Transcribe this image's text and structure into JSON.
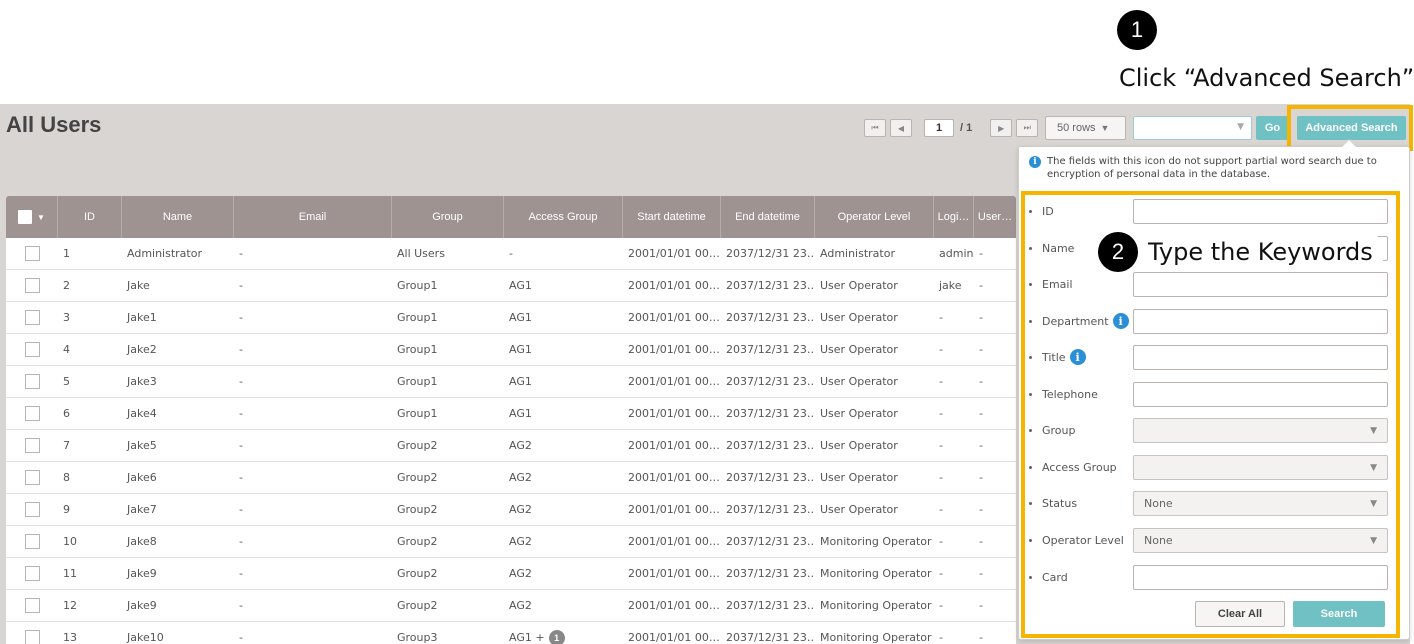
{
  "annotations": {
    "step1_number": "1",
    "step1_text": "Click “Advanced Search”",
    "step2_number": "2",
    "step2_text": "Type the Keywords",
    "highlight_color": "#f4b400"
  },
  "page": {
    "title": "All Users"
  },
  "pager": {
    "first_icon": "first-page-icon",
    "prev_icon": "prev-page-icon",
    "next_icon": "next-page-icon",
    "last_icon": "last-page-icon",
    "current_page": "1",
    "total": "/ 1"
  },
  "toolbar": {
    "rows_label": "50 rows",
    "go_label": "Go",
    "advanced_search_label": "Advanced Search",
    "accent_color": "#6fc1c4"
  },
  "table": {
    "columns": [
      "ID",
      "Name",
      "Email",
      "Group",
      "Access Group",
      "Start datetime",
      "End datetime",
      "Operator Level",
      "Logi…",
      "User…"
    ],
    "rows": [
      {
        "id": "1",
        "name": "Administrator",
        "email": "-",
        "group": "All Users",
        "access_group": "-",
        "start": "2001/01/01 00…",
        "end": "2037/12/31 23…",
        "level": "Administrator",
        "login": "admin",
        "user": "-"
      },
      {
        "id": "2",
        "name": "Jake",
        "email": "-",
        "group": "Group1",
        "access_group": "AG1",
        "start": "2001/01/01 00…",
        "end": "2037/12/31 23…",
        "level": "User Operator",
        "login": "jake",
        "user": "-"
      },
      {
        "id": "3",
        "name": "Jake1",
        "email": "-",
        "group": "Group1",
        "access_group": "AG1",
        "start": "2001/01/01 00…",
        "end": "2037/12/31 23…",
        "level": "User Operator",
        "login": "-",
        "user": "-"
      },
      {
        "id": "4",
        "name": "Jake2",
        "email": "-",
        "group": "Group1",
        "access_group": "AG1",
        "start": "2001/01/01 00…",
        "end": "2037/12/31 23…",
        "level": "User Operator",
        "login": "-",
        "user": "-"
      },
      {
        "id": "5",
        "name": "Jake3",
        "email": "-",
        "group": "Group1",
        "access_group": "AG1",
        "start": "2001/01/01 00…",
        "end": "2037/12/31 23…",
        "level": "User Operator",
        "login": "-",
        "user": "-"
      },
      {
        "id": "6",
        "name": "Jake4",
        "email": "-",
        "group": "Group1",
        "access_group": "AG1",
        "start": "2001/01/01 00…",
        "end": "2037/12/31 23…",
        "level": "User Operator",
        "login": "-",
        "user": "-"
      },
      {
        "id": "7",
        "name": "Jake5",
        "email": "-",
        "group": "Group2",
        "access_group": "AG2",
        "start": "2001/01/01 00…",
        "end": "2037/12/31 23…",
        "level": "User Operator",
        "login": "-",
        "user": "-"
      },
      {
        "id": "8",
        "name": "Jake6",
        "email": "-",
        "group": "Group2",
        "access_group": "AG2",
        "start": "2001/01/01 00…",
        "end": "2037/12/31 23…",
        "level": "User Operator",
        "login": "-",
        "user": "-"
      },
      {
        "id": "9",
        "name": "Jake7",
        "email": "-",
        "group": "Group2",
        "access_group": "AG2",
        "start": "2001/01/01 00…",
        "end": "2037/12/31 23…",
        "level": "User Operator",
        "login": "-",
        "user": "-"
      },
      {
        "id": "10",
        "name": "Jake8",
        "email": "-",
        "group": "Group2",
        "access_group": "AG2",
        "start": "2001/01/01 00…",
        "end": "2037/12/31 23…",
        "level": "Monitoring Operator",
        "login": "-",
        "user": "-"
      },
      {
        "id": "11",
        "name": "Jake9",
        "email": "-",
        "group": "Group2",
        "access_group": "AG2",
        "start": "2001/01/01 00…",
        "end": "2037/12/31 23…",
        "level": "Monitoring Operator",
        "login": "-",
        "user": "-"
      },
      {
        "id": "12",
        "name": "Jake9",
        "email": "-",
        "group": "Group2",
        "access_group": "AG2",
        "start": "2001/01/01 00…",
        "end": "2037/12/31 23…",
        "level": "Monitoring Operator",
        "login": "-",
        "user": "-"
      },
      {
        "id": "13",
        "name": "Jake10",
        "email": "-",
        "group": "Group3",
        "access_group": "AG1 +",
        "access_group_badge": "1",
        "start": "2001/01/01 00…",
        "end": "2037/12/31 23…",
        "level": "Monitoring Operator",
        "login": "-",
        "user": "-"
      }
    ]
  },
  "advanced_search": {
    "notice": "The fields with this icon do not support partial word search due to encryption of personal data in the database.",
    "info_icon": "info-icon",
    "fields": {
      "id": {
        "label": "ID",
        "value": ""
      },
      "name": {
        "label": "Name",
        "value": ""
      },
      "email": {
        "label": "Email",
        "value": ""
      },
      "department": {
        "label": "Department",
        "value": ""
      },
      "title": {
        "label": "Title",
        "value": ""
      },
      "telephone": {
        "label": "Telephone",
        "value": ""
      },
      "group": {
        "label": "Group",
        "value": ""
      },
      "access_group": {
        "label": "Access Group",
        "value": ""
      },
      "status": {
        "label": "Status",
        "value": "None"
      },
      "operator_level": {
        "label": "Operator Level",
        "value": "None"
      },
      "card": {
        "label": "Card",
        "value": ""
      }
    },
    "clear_label": "Clear All",
    "search_label": "Search"
  }
}
